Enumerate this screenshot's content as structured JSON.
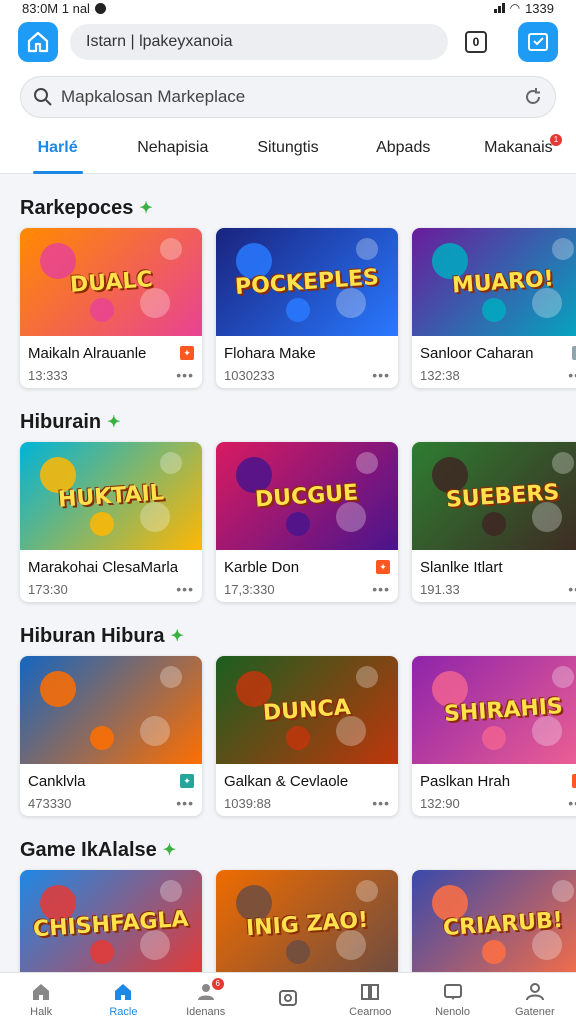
{
  "status_bar": {
    "time": "83:0M 1 nal",
    "battery": "1339"
  },
  "topbar": {
    "url": "Istarn | lpakeyxanoia",
    "tab_count": "0"
  },
  "search": {
    "placeholder": "Mapkalosan Markeplace"
  },
  "tabs": [
    {
      "label": "Harlé",
      "active": true
    },
    {
      "label": "Nehapisia"
    },
    {
      "label": "Situngtis"
    },
    {
      "label": "Abpads"
    },
    {
      "label": "Makanais",
      "badge": "1"
    }
  ],
  "sections": [
    {
      "title": "Rarkepoces",
      "cards": [
        {
          "title": "Maikaln Alrauanle",
          "meta": "13:333",
          "thumb_text": "DUALC",
          "colors": [
            "#ff8a00",
            "#e84393"
          ],
          "tag_color": "#ff5722"
        },
        {
          "title": "Flohara Make",
          "meta": "1030233",
          "thumb_text": "POCKEPLES",
          "colors": [
            "#1a237e",
            "#2979ff"
          ]
        },
        {
          "title": "Sanloor Caharan",
          "meta": "132:38",
          "thumb_text": "MUARO!",
          "colors": [
            "#6a1b9a",
            "#00acc1"
          ],
          "tag_color": "#90a4ae"
        }
      ]
    },
    {
      "title": "Hiburain",
      "cards": [
        {
          "title": "Marakohai ClesaMarla",
          "meta": "173:30",
          "thumb_text": "HUKTAIL",
          "colors": [
            "#00b4d8",
            "#ffb703"
          ]
        },
        {
          "title": "Karble Don",
          "meta": "17,3:330",
          "thumb_text": "DUCGUE",
          "colors": [
            "#d81b60",
            "#4a148c"
          ],
          "tag_color": "#ff5722"
        },
        {
          "title": "Slanlke Itlart",
          "meta": "191.33",
          "thumb_text": "SUEBERS",
          "colors": [
            "#2e7d32",
            "#3e2723"
          ]
        }
      ]
    },
    {
      "title": "Hiburan Hibura",
      "cards": [
        {
          "title": "Canklvla",
          "meta": "473330",
          "thumb_text": "",
          "colors": [
            "#1565c0",
            "#ff6f00"
          ],
          "tag_color": "#26a69a"
        },
        {
          "title": "Galkan & Cevlaole",
          "meta": "1039:88",
          "thumb_text": "DUNCA",
          "colors": [
            "#1b5e20",
            "#bf360c"
          ]
        },
        {
          "title": "Paslkan Hrah",
          "meta": "132:90",
          "thumb_text": "SHIRAHIS",
          "colors": [
            "#8e24aa",
            "#f06292"
          ],
          "tag_color": "#ff5722"
        }
      ]
    },
    {
      "title": "Game IkAlalse",
      "cards": [
        {
          "title": "",
          "meta": "",
          "thumb_text": "CHISHFAGLA",
          "colors": [
            "#1e88e5",
            "#e53935"
          ]
        },
        {
          "title": "",
          "meta": "",
          "thumb_text": "INIG ZAO!",
          "colors": [
            "#ef6c00",
            "#6d4c41"
          ]
        },
        {
          "title": "",
          "meta": "",
          "thumb_text": "CRIARUB!",
          "colors": [
            "#3949ab",
            "#ff7043"
          ]
        }
      ]
    }
  ],
  "bottom_nav": [
    {
      "label": "Halk",
      "icon": "home-icon"
    },
    {
      "label": "Racle",
      "icon": "home-filled-icon",
      "active": true
    },
    {
      "label": "Idenans",
      "icon": "profile-icon",
      "badge": "6"
    },
    {
      "label": "",
      "icon": "camera-icon"
    },
    {
      "label": "Cearnoo",
      "icon": "book-icon"
    },
    {
      "label": "Nenolo",
      "icon": "chat-icon"
    },
    {
      "label": "Gatener",
      "icon": "user-icon"
    }
  ]
}
